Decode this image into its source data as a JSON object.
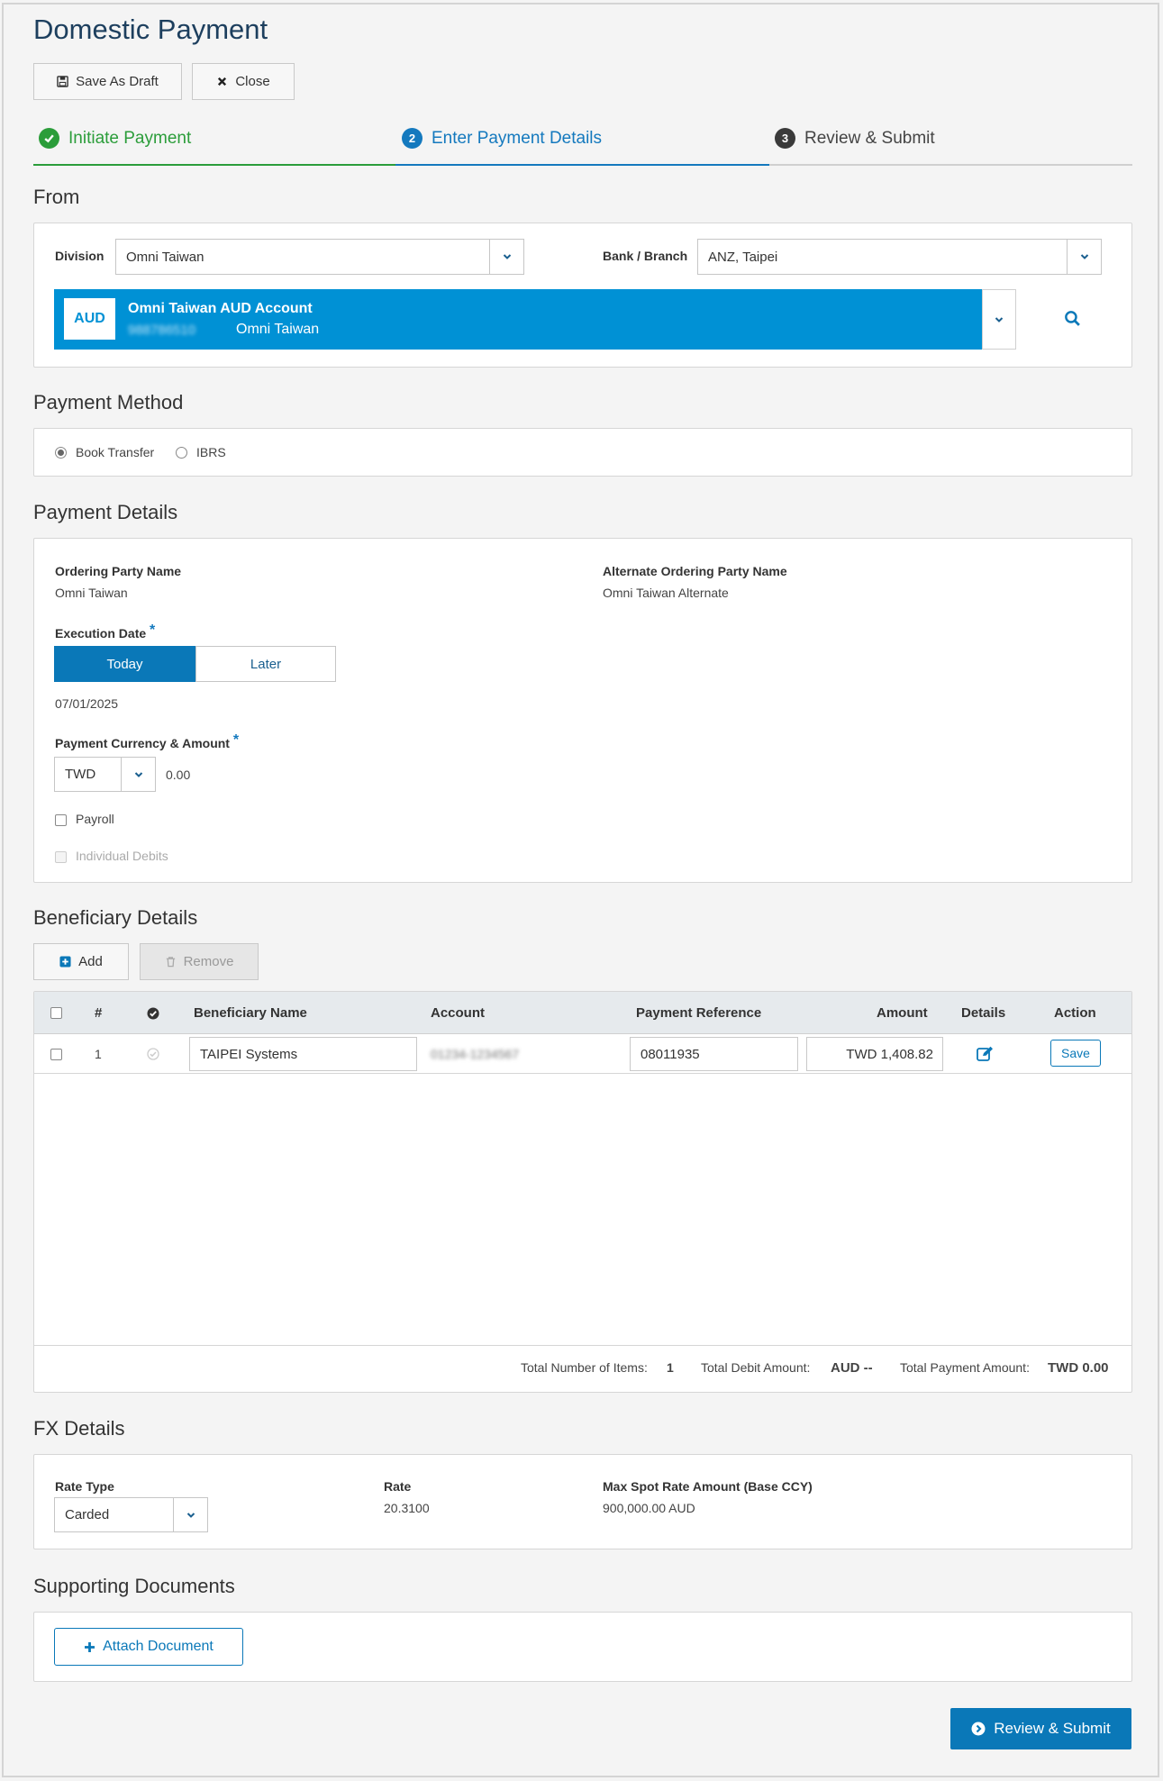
{
  "page": {
    "title": "Domestic Payment"
  },
  "toolbar": {
    "save_draft": "Save As Draft",
    "close": "Close"
  },
  "steps": [
    {
      "num": "1",
      "label": "Initiate Payment",
      "state": "complete"
    },
    {
      "num": "2",
      "label": "Enter Payment Details",
      "state": "active"
    },
    {
      "num": "3",
      "label": "Review & Submit",
      "state": "pending"
    }
  ],
  "from": {
    "title": "From",
    "division_label": "Division",
    "division_value": "Omni Taiwan",
    "bank_label": "Bank / Branch",
    "bank_value": "ANZ, Taipei",
    "account": {
      "currency": "AUD",
      "name": "Omni Taiwan AUD Account",
      "number": "988786510",
      "owner": "Omni Taiwan"
    }
  },
  "payment_method": {
    "title": "Payment Method",
    "options": [
      {
        "label": "Book Transfer",
        "selected": true
      },
      {
        "label": "IBRS",
        "selected": false
      }
    ]
  },
  "payment_details": {
    "title": "Payment Details",
    "ordering_party_label": "Ordering Party Name",
    "ordering_party_value": "Omni Taiwan",
    "alt_ordering_party_label": "Alternate Ordering Party Name",
    "alt_ordering_party_value": "Omni Taiwan Alternate",
    "execution_date_label": "Execution Date",
    "required_mark": "*",
    "today_label": "Today",
    "later_label": "Later",
    "execution_date_value": "07/01/2025",
    "currency_amount_label": "Payment Currency & Amount",
    "currency": "TWD",
    "amount": "0.00",
    "payroll_label": "Payroll",
    "individual_debits_label": "Individual Debits"
  },
  "beneficiary": {
    "title": "Beneficiary Details",
    "add_label": "Add",
    "remove_label": "Remove",
    "columns": {
      "num": "#",
      "name": "Beneficiary Name",
      "account": "Account",
      "reference": "Payment Reference",
      "amount": "Amount",
      "details": "Details",
      "action": "Action"
    },
    "rows": [
      {
        "num": "1",
        "name": "TAIPEI Systems",
        "account": "01234-1234567",
        "reference": "08011935",
        "amount": "TWD 1,408.82",
        "action": "Save"
      }
    ],
    "footer": {
      "items_label": "Total Number of Items:",
      "items_value": "1",
      "debit_label": "Total Debit Amount:",
      "debit_value": "AUD --",
      "payment_label": "Total Payment Amount:",
      "payment_value": "TWD 0.00"
    }
  },
  "fx": {
    "title": "FX Details",
    "rate_type_label": "Rate Type",
    "rate_type_value": "Carded",
    "rate_label": "Rate",
    "rate_value": "20.3100",
    "max_spot_label": "Max Spot Rate Amount (Base CCY)",
    "max_spot_value": "900,000.00 AUD"
  },
  "documents": {
    "title": "Supporting Documents",
    "attach_label": "Attach Document"
  },
  "submit": {
    "label": "Review & Submit"
  },
  "colors": {
    "primary": "#0091d5",
    "dark_primary": "#0a78b8",
    "success": "#2b9d3a",
    "step_active": "#1479be"
  }
}
